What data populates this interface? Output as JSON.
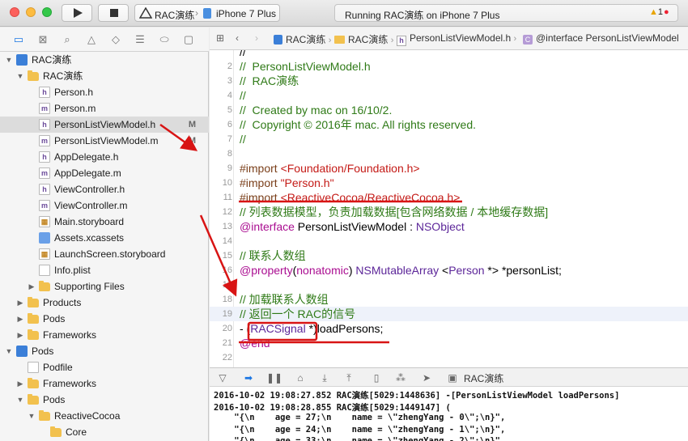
{
  "toolbar": {
    "scheme": "RAC演练",
    "scheme_separator": "›",
    "device": "iPhone 7 Plus",
    "status": "Running RAC演练 on iPhone 7 Plus",
    "warning_count": "1",
    "error_count": "1",
    "colors": {
      "close": "#fc605c",
      "minimize": "#fdbc40",
      "maximize": "#34c84a"
    }
  },
  "navigator": {
    "tab_icons": [
      "folder-icon",
      "source-control-icon",
      "search-icon",
      "issue-warning-icon",
      "test-diamond-icon",
      "debug-list-icon",
      "breakpoint-icon",
      "report-icon"
    ],
    "items": [
      {
        "label": "RAC演练",
        "icon": "project-icon",
        "depth": 0,
        "disclosure": "▼"
      },
      {
        "label": "RAC演练",
        "icon": "folder-icon",
        "depth": 1,
        "disclosure": "▼"
      },
      {
        "label": "Person.h",
        "icon": "h-file-icon",
        "depth": 2
      },
      {
        "label": "Person.m",
        "icon": "m-file-icon",
        "depth": 2
      },
      {
        "label": "PersonListViewModel.h",
        "icon": "h-file-icon",
        "depth": 2,
        "badge": "M",
        "selected": true
      },
      {
        "label": "PersonListViewModel.m",
        "icon": "m-file-icon",
        "depth": 2,
        "badge": "M"
      },
      {
        "label": "AppDelegate.h",
        "icon": "h-file-icon",
        "depth": 2
      },
      {
        "label": "AppDelegate.m",
        "icon": "m-file-icon",
        "depth": 2
      },
      {
        "label": "ViewController.h",
        "icon": "h-file-icon",
        "depth": 2
      },
      {
        "label": "ViewController.m",
        "icon": "m-file-icon",
        "depth": 2
      },
      {
        "label": "Main.storyboard",
        "icon": "storyboard-icon",
        "depth": 2
      },
      {
        "label": "Assets.xcassets",
        "icon": "assets-icon",
        "depth": 2
      },
      {
        "label": "LaunchScreen.storyboard",
        "icon": "storyboard-icon",
        "depth": 2
      },
      {
        "label": "Info.plist",
        "icon": "plist-icon",
        "depth": 2
      },
      {
        "label": "Supporting Files",
        "icon": "folder-icon",
        "depth": 2,
        "disclosure": "▶"
      },
      {
        "label": "Products",
        "icon": "folder-icon",
        "depth": 1,
        "disclosure": "▶"
      },
      {
        "label": "Pods",
        "icon": "folder-icon",
        "depth": 1,
        "disclosure": "▶"
      },
      {
        "label": "Frameworks",
        "icon": "folder-icon",
        "depth": 1,
        "disclosure": "▶"
      },
      {
        "label": "Pods",
        "icon": "project-icon",
        "depth": 0,
        "disclosure": "▼"
      },
      {
        "label": "Podfile",
        "icon": "plain-file-icon",
        "depth": 1
      },
      {
        "label": "Frameworks",
        "icon": "folder-icon",
        "depth": 1,
        "disclosure": "▶"
      },
      {
        "label": "Pods",
        "icon": "folder-icon",
        "depth": 1,
        "disclosure": "▼"
      },
      {
        "label": "ReactiveCocoa",
        "icon": "folder-icon",
        "depth": 2,
        "disclosure": "▼"
      },
      {
        "label": "Core",
        "icon": "folder-icon",
        "depth": 3
      }
    ]
  },
  "jumpbar": {
    "crumbs": [
      "RAC演练",
      "RAC演练",
      "PersonListViewModel.h",
      "@interface PersonListViewModel"
    ]
  },
  "editor": {
    "first_partial_line": "//",
    "lines": [
      {
        "n": "2",
        "t": [
          [
            "cm",
            "//  PersonListViewModel.h"
          ]
        ]
      },
      {
        "n": "3",
        "t": [
          [
            "cm",
            "//  RAC演练"
          ]
        ]
      },
      {
        "n": "4",
        "t": [
          [
            "cm",
            "//"
          ]
        ]
      },
      {
        "n": "5",
        "t": [
          [
            "cm",
            "//  Created by mac on 16/10/2."
          ]
        ]
      },
      {
        "n": "6",
        "t": [
          [
            "cm",
            "//  Copyright © 2016年 mac. All rights reserved."
          ]
        ]
      },
      {
        "n": "7",
        "t": [
          [
            "cm",
            "//"
          ]
        ]
      },
      {
        "n": "8",
        "t": []
      },
      {
        "n": "9",
        "t": [
          [
            "pp",
            "#import "
          ],
          [
            "str",
            "<Foundation/Foundation.h>"
          ]
        ]
      },
      {
        "n": "10",
        "t": [
          [
            "pp",
            "#import "
          ],
          [
            "str",
            "\"Person.h\""
          ]
        ]
      },
      {
        "n": "11",
        "t": [
          [
            "pp",
            "#import "
          ],
          [
            "str",
            "<ReactiveCocoa/ReactiveCocoa.h>"
          ]
        ]
      },
      {
        "n": "12",
        "t": [
          [
            "cm",
            "// 列表数据模型，负责加载数据[包含网络数据 / 本地缓存数据]"
          ]
        ]
      },
      {
        "n": "13",
        "t": [
          [
            "kw",
            "@interface"
          ],
          [
            "",
            " PersonListViewModel : "
          ],
          [
            "ty",
            "NSObject"
          ]
        ]
      },
      {
        "n": "14",
        "t": []
      },
      {
        "n": "15",
        "t": [
          [
            "cm",
            "// 联系人数组"
          ]
        ]
      },
      {
        "n": "16",
        "t": [
          [
            "kw",
            "@property"
          ],
          [
            "",
            "("
          ],
          [
            "kw",
            "nonatomic"
          ],
          [
            "",
            ") "
          ],
          [
            "ty",
            "NSMutableArray"
          ],
          [
            "",
            " <"
          ],
          [
            "ty",
            "Person"
          ],
          [
            "",
            " *> *personList;"
          ]
        ]
      },
      {
        "n": "17",
        "t": []
      },
      {
        "n": "18",
        "t": [
          [
            "cm",
            "// 加载联系人数组"
          ]
        ]
      },
      {
        "n": "19",
        "t": [
          [
            "cm",
            "// 返回一个 RAC的信号"
          ]
        ],
        "current": true
      },
      {
        "n": "20",
        "t": [
          [
            "",
            "- ("
          ],
          [
            "ty",
            "RACSignal"
          ],
          [
            "",
            " *)loadPersons;"
          ]
        ]
      },
      {
        "n": "21",
        "t": [
          [
            "kw",
            "@end"
          ]
        ]
      },
      {
        "n": "22",
        "t": []
      }
    ]
  },
  "debug": {
    "target_label": "RAC演练",
    "console_lines": [
      "2016-10-02 19:08:27.852 RAC演练[5029:1448636] -[PersonListViewModel loadPersons]",
      "2016-10-02 19:08:28.855 RAC演练[5029:1449147] (",
      "    \"{\\n    age = 27;\\n    name = \\\"zhengYang - 0\\\";\\n}\",",
      "    \"{\\n    age = 24;\\n    name = \\\"zhengYang - 1\\\";\\n}\",",
      "    \"{\\n    age = 33;\\n    name = \\\"zhengYang - 2\\\";\\n}\","
    ]
  }
}
